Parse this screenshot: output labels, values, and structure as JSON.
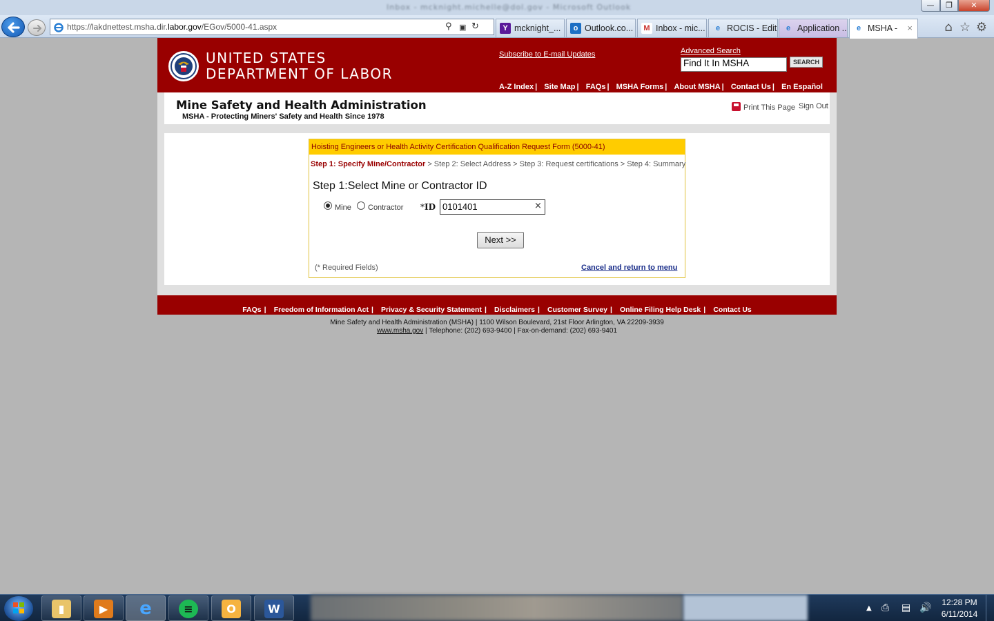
{
  "browser": {
    "window_title": "Inbox - mcknight.michelle@dol.gov - Microsoft Outlook",
    "url_prefix": "https://lakdnettest.msha.dir.",
    "url_domain": "labor.gov",
    "url_suffix": "/EGov/5000-41.aspx",
    "tabs": [
      {
        "label": "mcknight_...",
        "icon": "yahoo-icon"
      },
      {
        "label": "Outlook.co...",
        "icon": "outlook-icon"
      },
      {
        "label": "Inbox - mic...",
        "icon": "gmail-icon"
      },
      {
        "label": "ROCIS - Edit...",
        "icon": "ie-icon"
      },
      {
        "label": "Application ...",
        "icon": "ie-icon"
      },
      {
        "label": "MSHA -",
        "icon": "ie-icon"
      }
    ],
    "tab_close": "×"
  },
  "header": {
    "line1": "UNITED STATES",
    "line2": "DEPARTMENT OF LABOR",
    "subscribe": "Subscribe to E-mail Updates",
    "advanced_search": "Advanced Search",
    "search_value": "Find It In MSHA",
    "search_button": "SEARCH",
    "nav": [
      "A-Z Index",
      "Site Map",
      "FAQs",
      "MSHA Forms",
      "About MSHA",
      "Contact Us",
      "En Español"
    ],
    "nav_sep": "|"
  },
  "subheader": {
    "title": "Mine Safety and Health Administration",
    "tagline": "MSHA - Protecting Miners' Safety and Health Since 1978",
    "print": "Print This Page",
    "signout": "Sign Out"
  },
  "form": {
    "title": "Hoisting Engineers or Health Activity Certification Qualification Request Form (5000-41)",
    "steps": {
      "current": "Step 1: Specify Mine/Contractor",
      "rest": " > Step 2: Select Address > Step 3: Request certifications > Step 4: Summary"
    },
    "heading": "Step 1:Select Mine or Contractor ID",
    "radio_mine": "Mine",
    "radio_contractor": "Contractor",
    "selected": "Mine",
    "id_star": "*",
    "id_label": "ID",
    "id_value": "0101401",
    "clear_glyph": "×",
    "next_button": "Next >>",
    "required_note": "(* Required Fields)",
    "cancel_link": "Cancel and return to menu"
  },
  "footer": {
    "links": [
      "FAQs",
      "Freedom of Information Act",
      "Privacy & Security Statement",
      "Disclaimers",
      "Customer Survey",
      "Online Filing Help Desk",
      "Contact Us"
    ],
    "sep": "|",
    "address": "Mine Safety and Health Administration (MSHA) | 1100 Wilson Boulevard, 21st Floor Arlington, VA 22209-3939",
    "site": "www.msha.gov",
    "phones": " | Telephone: (202) 693-9400 | Fax-on-demand: (202) 693-9401"
  },
  "taskbar": {
    "apps": [
      "windows-explorer",
      "media-player",
      "internet-explorer",
      "spotify",
      "outlook",
      "word"
    ],
    "time": "12:28 PM",
    "date": "6/11/2014"
  },
  "colors": {
    "dol_red": "#990000",
    "form_header_yellow": "#ffcc00",
    "link_blue": "#1a2e8a"
  }
}
